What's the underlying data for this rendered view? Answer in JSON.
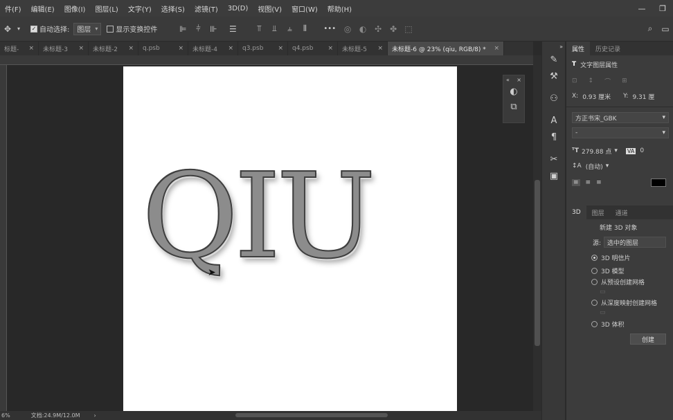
{
  "menu": [
    "件(F)",
    "编辑(E)",
    "图像(I)",
    "图层(L)",
    "文字(Y)",
    "选择(S)",
    "滤镜(T)",
    "3D(D)",
    "视图(V)",
    "窗口(W)",
    "帮助(H)"
  ],
  "options": {
    "auto_select_label": "自动选择:",
    "auto_select_value": "图层",
    "show_transform_label": "显示变换控件",
    "more_label": "•••"
  },
  "tabs": [
    {
      "label": "标题-"
    },
    {
      "label": "未标题-3"
    },
    {
      "label": "未标题-2"
    },
    {
      "label": "q.psb"
    },
    {
      "label": "未标题-4"
    },
    {
      "label": "q3.psb"
    },
    {
      "label": "q4.psb"
    },
    {
      "label": "未标题-5"
    },
    {
      "label": "未标题-6 @ 23% (qiu, RGB/8) *"
    }
  ],
  "canvas": {
    "text": "QIU"
  },
  "status": {
    "zoom": "6%",
    "doc": "文档:24.9M/12.0M"
  },
  "properties": {
    "tab_properties": "属性",
    "tab_history": "历史记录",
    "header": "文字图层属性",
    "x_label": "X:",
    "x_value": "0.93 厘米",
    "y_label": "Y:",
    "y_value": "9.31 厘",
    "font": "方正书宋_GBK",
    "size": "279.88 点",
    "tracking": "0",
    "leading": "(自动)",
    "color": "#000000"
  },
  "panel3d": {
    "tab_3d": "3D",
    "tab_layers": "图层",
    "tab_channels": "通道",
    "new_object": "新建 3D 对象",
    "source_label": "源:",
    "source_value": "选中的图层",
    "opt1": "3D 明信片",
    "opt2": "3D 模型",
    "opt3": "从预设创建网格",
    "opt4": "从深度映射创建网格",
    "opt5": "3D 体积",
    "create": "创建"
  }
}
